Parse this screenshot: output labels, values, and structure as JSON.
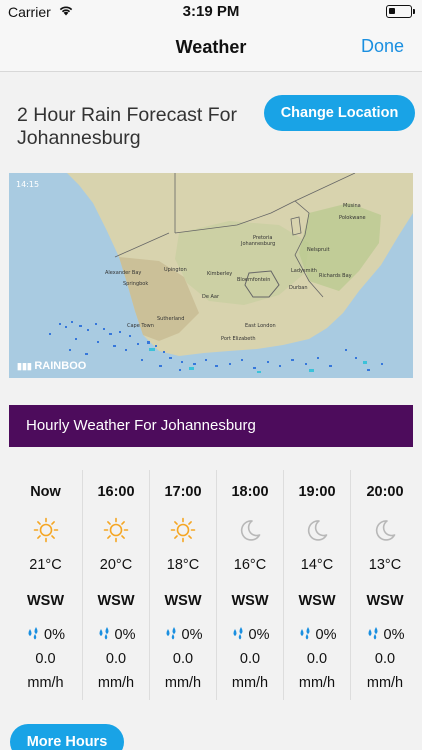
{
  "status_bar": {
    "carrier": "Carrier",
    "time": "3:19 PM"
  },
  "nav": {
    "title": "Weather",
    "done_label": "Done"
  },
  "forecast": {
    "title": "2 Hour Rain Forecast For Johannesburg",
    "change_location_label": "Change Location"
  },
  "map": {
    "timestamp": "14:15",
    "logo_text": "RAINBOO",
    "cities": [
      "Musina",
      "Polokwane",
      "Pretoria",
      "Johannesburg",
      "Nelspruit",
      "Alexander Bay",
      "Upington",
      "Kimberley",
      "Bloemfontein",
      "Ladysmith",
      "Richards Bay",
      "Springbok",
      "Durban",
      "De Aar",
      "Sutherland",
      "East London",
      "Port Elizabeth",
      "Cape Town"
    ]
  },
  "hourly": {
    "banner": "Hourly Weather For Johannesburg",
    "unit": "mm/h",
    "hours": [
      {
        "label": "Now",
        "icon": "sun-icon",
        "temp": "21°C",
        "wind": "WSW",
        "rain_chance": "0%",
        "rain_amount": "0.0"
      },
      {
        "label": "16:00",
        "icon": "sun-icon",
        "temp": "20°C",
        "wind": "WSW",
        "rain_chance": "0%",
        "rain_amount": "0.0"
      },
      {
        "label": "17:00",
        "icon": "sun-icon",
        "temp": "18°C",
        "wind": "WSW",
        "rain_chance": "0%",
        "rain_amount": "0.0"
      },
      {
        "label": "18:00",
        "icon": "moon-icon",
        "temp": "16°C",
        "wind": "WSW",
        "rain_chance": "0%",
        "rain_amount": "0.0"
      },
      {
        "label": "19:00",
        "icon": "moon-icon",
        "temp": "14°C",
        "wind": "WSW",
        "rain_chance": "0%",
        "rain_amount": "0.0"
      },
      {
        "label": "20:00",
        "icon": "moon-icon",
        "temp": "13°C",
        "wind": "WSW",
        "rain_chance": "0%",
        "rain_amount": "0.0"
      }
    ]
  },
  "more_hours_label": "More Hours",
  "colors": {
    "accent": "#19a3e6",
    "banner": "#4d0c5c",
    "sun": "#f5a623",
    "moon": "#b8b8b8",
    "drop": "#1a8fe0"
  }
}
